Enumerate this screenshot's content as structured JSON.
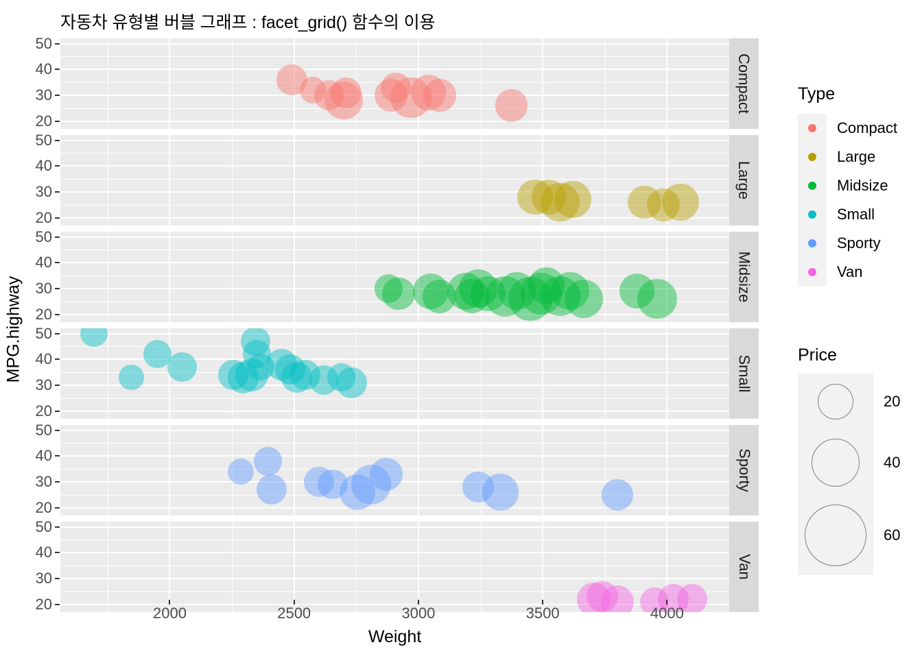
{
  "chart_data": {
    "type": "scatter",
    "title": "자동차 유형별 버블 그래프 : facet_grid() 함수의 이용",
    "xlabel": "Weight",
    "ylabel": "MPG.highway",
    "xlim": [
      1560,
      4250
    ],
    "ylim": [
      17,
      52
    ],
    "xticks": [
      2000,
      2500,
      3000,
      3500,
      4000
    ],
    "yticks": [
      20,
      30,
      40,
      50
    ],
    "grid": true,
    "size_variable": "Price",
    "color_variable": "Type",
    "facet_variable": "Type",
    "facet_type": "facet_grid rows",
    "facets": [
      "Compact",
      "Large",
      "Midsize",
      "Small",
      "Sporty",
      "Van"
    ],
    "legend_position": "right",
    "type_legend": {
      "title": "Type",
      "entries": [
        {
          "label": "Compact",
          "color": "#f8766d"
        },
        {
          "label": "Large",
          "color": "#b79f00"
        },
        {
          "label": "Midsize",
          "color": "#00ba38"
        },
        {
          "label": "Small",
          "color": "#00bfc4"
        },
        {
          "label": "Sporty",
          "color": "#619cff"
        },
        {
          "label": "Van",
          "color": "#f564e3"
        }
      ]
    },
    "size_legend": {
      "title": "Price",
      "breaks": [
        20,
        40,
        60
      ],
      "labels": [
        "20",
        "40",
        "60"
      ]
    },
    "series": [
      {
        "name": "Compact",
        "color": "#f8766d",
        "points": [
          {
            "weight": 2490,
            "mpg": 36,
            "price": 26
          },
          {
            "weight": 2575,
            "mpg": 32,
            "price": 19
          },
          {
            "weight": 2640,
            "mpg": 30,
            "price": 24
          },
          {
            "weight": 2700,
            "mpg": 28,
            "price": 41
          },
          {
            "weight": 2710,
            "mpg": 31,
            "price": 26
          },
          {
            "weight": 2890,
            "mpg": 30,
            "price": 31
          },
          {
            "weight": 2910,
            "mpg": 33,
            "price": 25
          },
          {
            "weight": 2970,
            "mpg": 29,
            "price": 47
          },
          {
            "weight": 3040,
            "mpg": 31,
            "price": 35
          },
          {
            "weight": 3085,
            "mpg": 30,
            "price": 30
          },
          {
            "weight": 3375,
            "mpg": 26,
            "price": 29
          }
        ]
      },
      {
        "name": "Large",
        "color": "#b79f00",
        "points": [
          {
            "weight": 3470,
            "mpg": 28,
            "price": 35
          },
          {
            "weight": 3525,
            "mpg": 28,
            "price": 33
          },
          {
            "weight": 3570,
            "mpg": 26,
            "price": 42
          },
          {
            "weight": 3620,
            "mpg": 27,
            "price": 38
          },
          {
            "weight": 3910,
            "mpg": 26,
            "price": 31
          },
          {
            "weight": 3985,
            "mpg": 25,
            "price": 30
          },
          {
            "weight": 4055,
            "mpg": 26,
            "price": 38
          }
        ]
      },
      {
        "name": "Midsize",
        "color": "#00ba38",
        "points": [
          {
            "weight": 2880,
            "mpg": 30,
            "price": 22
          },
          {
            "weight": 2920,
            "mpg": 28,
            "price": 29
          },
          {
            "weight": 3050,
            "mpg": 29,
            "price": 36
          },
          {
            "weight": 3085,
            "mpg": 27,
            "price": 31
          },
          {
            "weight": 3190,
            "mpg": 29,
            "price": 39
          },
          {
            "weight": 3215,
            "mpg": 27,
            "price": 33
          },
          {
            "weight": 3240,
            "mpg": 30,
            "price": 42
          },
          {
            "weight": 3280,
            "mpg": 28,
            "price": 35
          },
          {
            "weight": 3350,
            "mpg": 27,
            "price": 46
          },
          {
            "weight": 3395,
            "mpg": 29,
            "price": 40
          },
          {
            "weight": 3450,
            "mpg": 26,
            "price": 55
          },
          {
            "weight": 3495,
            "mpg": 28,
            "price": 48
          },
          {
            "weight": 3515,
            "mpg": 31,
            "price": 38
          },
          {
            "weight": 3570,
            "mpg": 27,
            "price": 45
          },
          {
            "weight": 3610,
            "mpg": 29,
            "price": 40
          },
          {
            "weight": 3665,
            "mpg": 26,
            "price": 42
          },
          {
            "weight": 3880,
            "mpg": 29,
            "price": 34
          },
          {
            "weight": 3960,
            "mpg": 26,
            "price": 44
          }
        ]
      },
      {
        "name": "Small",
        "color": "#00bfc4",
        "points": [
          {
            "weight": 1695,
            "mpg": 50,
            "price": 20
          },
          {
            "weight": 1845,
            "mpg": 33,
            "price": 17
          },
          {
            "weight": 1950,
            "mpg": 42,
            "price": 22
          },
          {
            "weight": 2050,
            "mpg": 37,
            "price": 23
          },
          {
            "weight": 2255,
            "mpg": 34,
            "price": 25
          },
          {
            "weight": 2295,
            "mpg": 33,
            "price": 27
          },
          {
            "weight": 2330,
            "mpg": 34,
            "price": 30
          },
          {
            "weight": 2345,
            "mpg": 47,
            "price": 23
          },
          {
            "weight": 2350,
            "mpg": 42,
            "price": 22
          },
          {
            "weight": 2365,
            "mpg": 37,
            "price": 20
          },
          {
            "weight": 2450,
            "mpg": 38,
            "price": 27
          },
          {
            "weight": 2485,
            "mpg": 36,
            "price": 25
          },
          {
            "weight": 2510,
            "mpg": 33,
            "price": 26
          },
          {
            "weight": 2545,
            "mpg": 34,
            "price": 24
          },
          {
            "weight": 2620,
            "mpg": 32,
            "price": 23
          },
          {
            "weight": 2690,
            "mpg": 33,
            "price": 21
          },
          {
            "weight": 2730,
            "mpg": 31,
            "price": 26
          }
        ]
      },
      {
        "name": "Sporty",
        "color": "#619cff",
        "points": [
          {
            "weight": 2285,
            "mpg": 34,
            "price": 18
          },
          {
            "weight": 2395,
            "mpg": 38,
            "price": 22
          },
          {
            "weight": 2410,
            "mpg": 27,
            "price": 25
          },
          {
            "weight": 2600,
            "mpg": 30,
            "price": 26
          },
          {
            "weight": 2655,
            "mpg": 29,
            "price": 24
          },
          {
            "weight": 2755,
            "mpg": 26,
            "price": 36
          },
          {
            "weight": 2810,
            "mpg": 29,
            "price": 44
          },
          {
            "weight": 2870,
            "mpg": 33,
            "price": 30
          },
          {
            "weight": 3240,
            "mpg": 28,
            "price": 27
          },
          {
            "weight": 3330,
            "mpg": 26,
            "price": 38
          },
          {
            "weight": 3800,
            "mpg": 25,
            "price": 28
          }
        ]
      },
      {
        "name": "Van",
        "color": "#f564e3",
        "points": [
          {
            "weight": 3705,
            "mpg": 22,
            "price": 31
          },
          {
            "weight": 3740,
            "mpg": 23,
            "price": 27
          },
          {
            "weight": 3800,
            "mpg": 21,
            "price": 30
          },
          {
            "weight": 3950,
            "mpg": 21,
            "price": 23
          },
          {
            "weight": 4025,
            "mpg": 22,
            "price": 26
          },
          {
            "weight": 4100,
            "mpg": 22,
            "price": 25
          }
        ]
      }
    ]
  }
}
